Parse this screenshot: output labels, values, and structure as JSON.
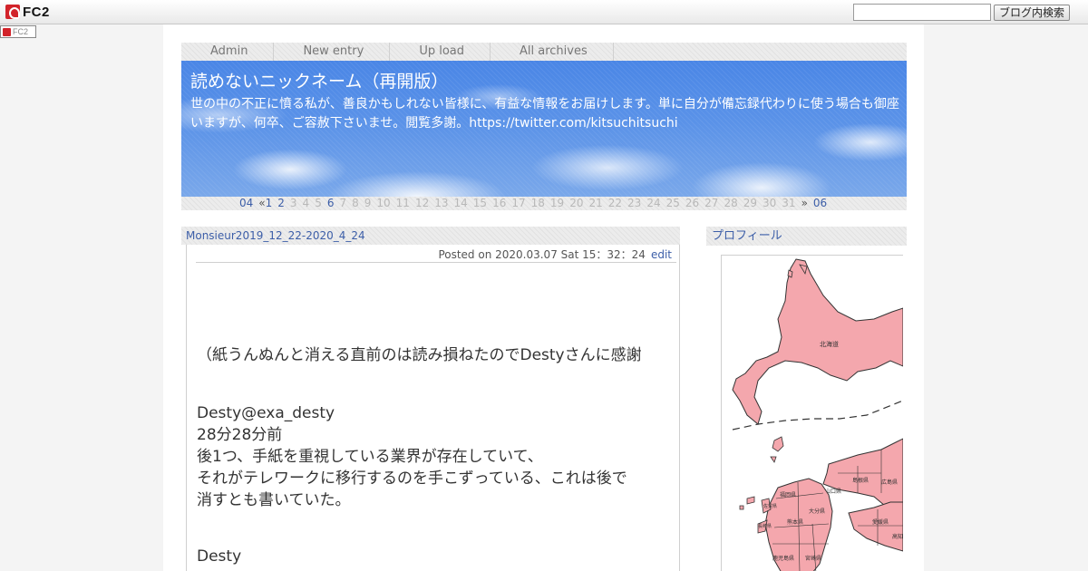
{
  "fc2_bar": {
    "logo_text": "FC2",
    "search": {
      "value": "",
      "placeholder": ""
    },
    "search_button": "ブログ内検索",
    "mini_badge": "FC2"
  },
  "nav": [
    "Admin",
    "New entry",
    "Up load",
    "All archives"
  ],
  "blog": {
    "title": "読めないニックネーム（再開版）",
    "description": "世の中の不正に憤る私が、善良かもしれない皆様に、有益な情報をお届けします。単に自分が備忘録代わりに使う場合も御座いますが、何卒、ご容赦下さいませ。閲覧多謝。https://twitter.com/kitsuchitsuchi"
  },
  "calendar": {
    "prev_month": "04",
    "prev_symbol": "«",
    "next_symbol": "»",
    "next_month": "06",
    "days": [
      {
        "d": "1",
        "link": true
      },
      {
        "d": "2",
        "link": true
      },
      {
        "d": "3",
        "link": false
      },
      {
        "d": "4",
        "link": false
      },
      {
        "d": "5",
        "link": false
      },
      {
        "d": "6",
        "link": true
      },
      {
        "d": "7",
        "link": false
      },
      {
        "d": "8",
        "link": false
      },
      {
        "d": "9",
        "link": false
      },
      {
        "d": "10",
        "link": false
      },
      {
        "d": "11",
        "link": false
      },
      {
        "d": "12",
        "link": false
      },
      {
        "d": "13",
        "link": false
      },
      {
        "d": "14",
        "link": false
      },
      {
        "d": "15",
        "link": false
      },
      {
        "d": "16",
        "link": false
      },
      {
        "d": "17",
        "link": false
      },
      {
        "d": "18",
        "link": false
      },
      {
        "d": "19",
        "link": false
      },
      {
        "d": "20",
        "link": false
      },
      {
        "d": "21",
        "link": false
      },
      {
        "d": "22",
        "link": false
      },
      {
        "d": "23",
        "link": false
      },
      {
        "d": "24",
        "link": false
      },
      {
        "d": "25",
        "link": false
      },
      {
        "d": "26",
        "link": false
      },
      {
        "d": "27",
        "link": false
      },
      {
        "d": "28",
        "link": false
      },
      {
        "d": "29",
        "link": false
      },
      {
        "d": "30",
        "link": false
      },
      {
        "d": "31",
        "link": false
      }
    ]
  },
  "entry": {
    "title": "Monsieur2019_12_22-2020_4_24",
    "posted": "Posted on 2020.03.07 Sat 15：32：24",
    "edit": "edit",
    "lines": {
      "l1": "（紙うんぬんと消える直前のは読み損ねたのでDestyさんに感謝",
      "l2": "Desty@exa_desty",
      "l3": "28分28分前",
      "l4": "後1つ、手紙を重視している業界が存在していて、",
      "l5": "それがテレワークに移行するのを手こずっている、これは後で",
      "l6": "消すとも書いていた。",
      "l7": "Desty"
    }
  },
  "sidebar": {
    "profile_title": "プロフィール",
    "map_labels": {
      "hokkaido": "北海道",
      "yamaguchi": "山口県",
      "hiroshima": "広島県",
      "shimane": "島根県",
      "fukuoka": "福岡県",
      "oita": "大分県",
      "kumamoto": "熊本県",
      "nagasaki": "長崎県",
      "saga": "佐賀県",
      "miyazaki": "宮崎県",
      "kagoshima": "鹿児島県",
      "ehime": "愛媛県",
      "kochi": "高知県"
    },
    "map_colors": {
      "land": "#f4a7ad",
      "border": "#333333",
      "water": "#ffffff"
    }
  }
}
